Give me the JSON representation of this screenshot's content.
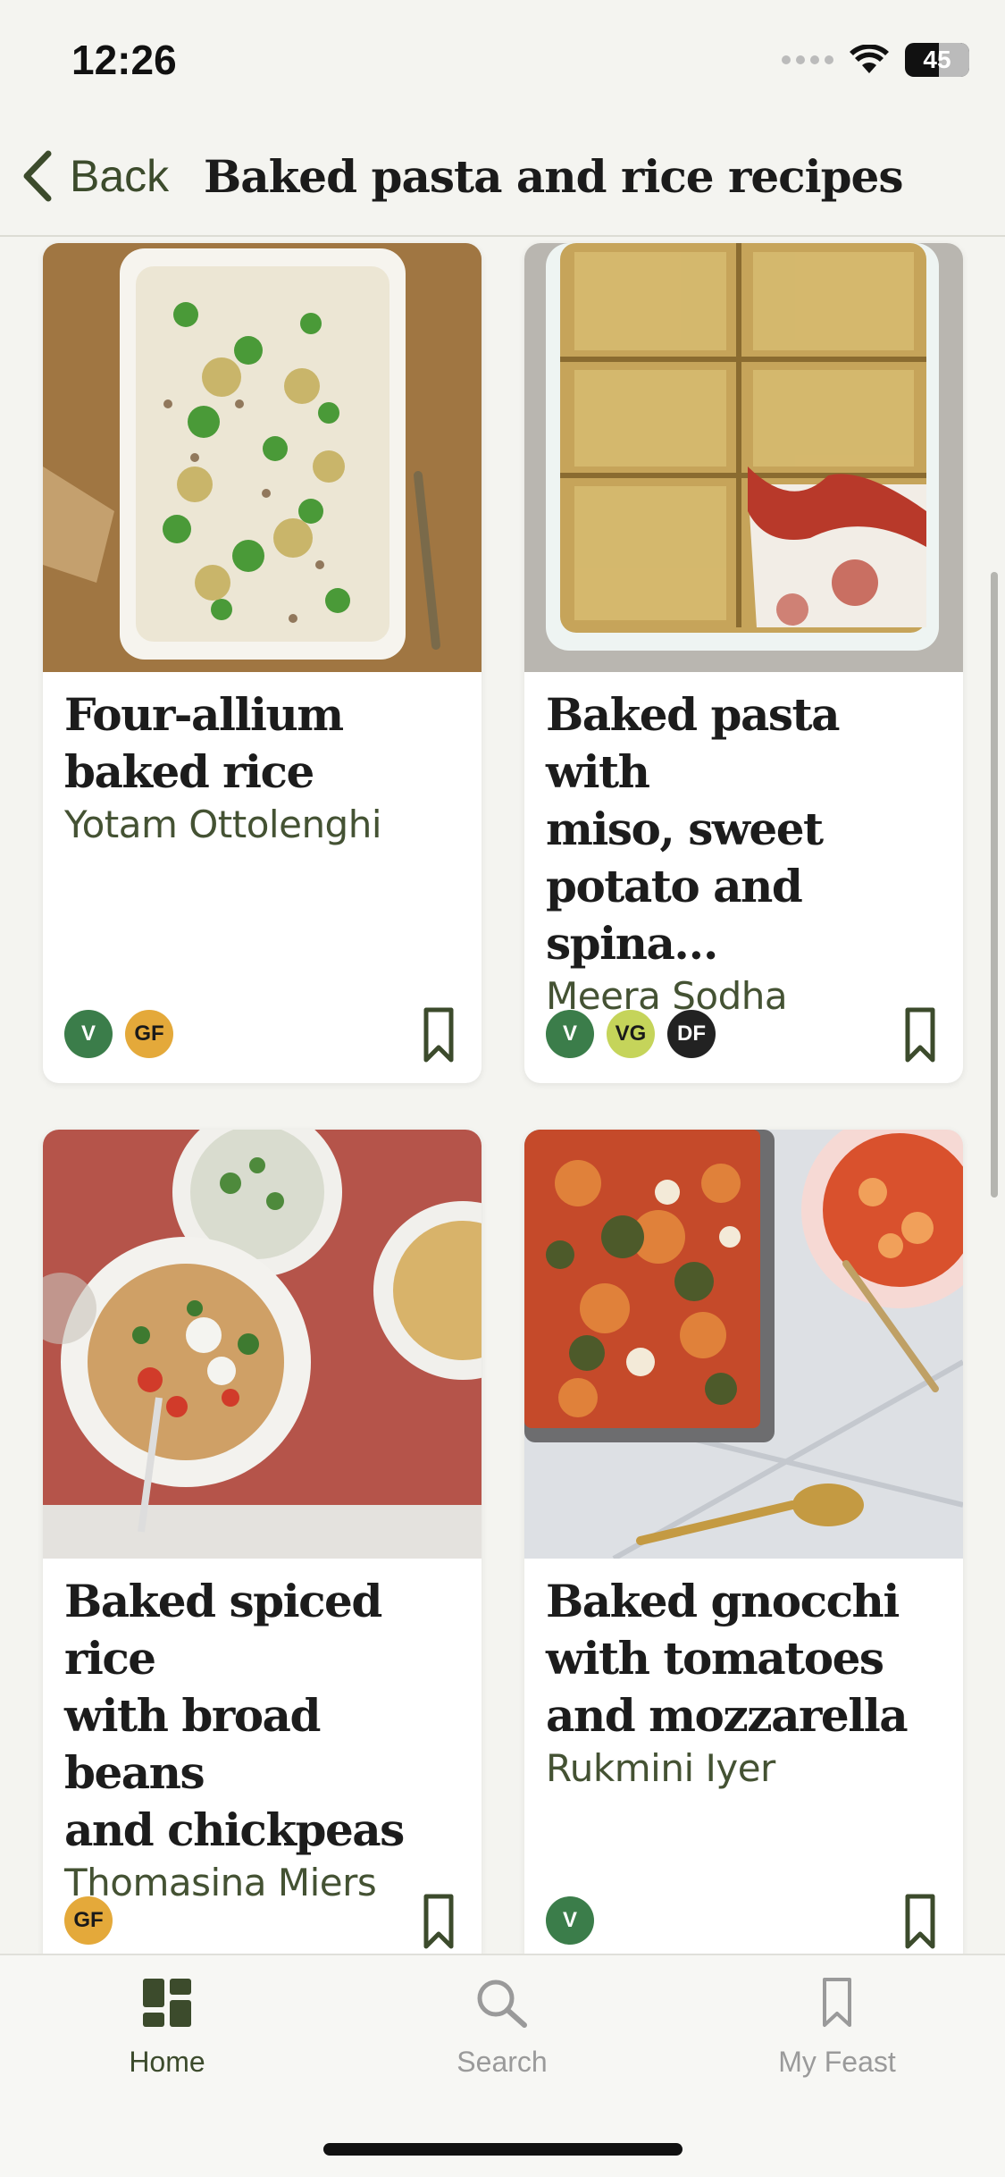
{
  "status_bar": {
    "time": "12:26",
    "battery": "45"
  },
  "nav": {
    "back_label": "Back",
    "title": "Baked pasta and rice recipes"
  },
  "recipes": [
    {
      "title_line1": "Four-allium",
      "title_line2": "baked rice",
      "title_line3": "",
      "author": "Yotam Ottolenghi",
      "tags": [
        "V",
        "GF"
      ]
    },
    {
      "title_line1": "Baked pasta with",
      "title_line2": "miso, sweet",
      "title_line3": "potato and spina…",
      "author": "Meera Sodha",
      "tags": [
        "V",
        "VG",
        "DF"
      ]
    },
    {
      "title_line1": "Baked spiced rice",
      "title_line2": "with broad beans",
      "title_line3": "and chickpeas",
      "author": "Thomasina Miers",
      "tags": [
        "GF"
      ]
    },
    {
      "title_line1": "Baked gnocchi",
      "title_line2": "with tomatoes",
      "title_line3": "and mozzarella",
      "author": "Rukmini Iyer",
      "tags": [
        "V"
      ]
    }
  ],
  "tab_bar": {
    "tabs": [
      {
        "label": "Home",
        "icon": "home-grid-icon",
        "active": true
      },
      {
        "label": "Search",
        "icon": "search-icon",
        "active": false
      },
      {
        "label": "My Feast",
        "icon": "bookmark-icon",
        "active": false
      }
    ]
  },
  "colors": {
    "accent": "#3c4b2c",
    "tag_v": "#3b7d4a",
    "tag_gf": "#e4a93a",
    "tag_vg": "#c5d45a",
    "tag_df": "#222222",
    "inactive": "#9a9a9a"
  }
}
